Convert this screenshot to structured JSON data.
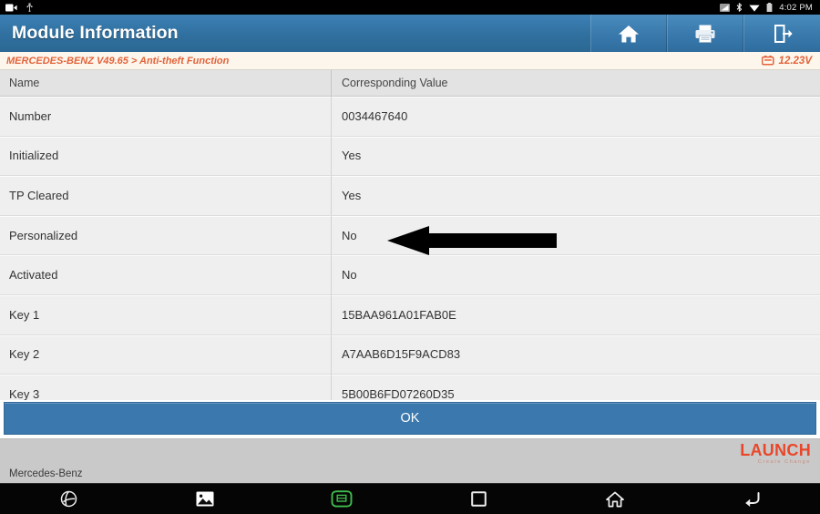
{
  "status_bar": {
    "left_icons": [
      "screen-record-icon",
      "usb-icon"
    ],
    "right_icons": [
      "signal-icon",
      "bluetooth-icon",
      "wifi-icon",
      "battery-icon"
    ],
    "time": "4:02 PM"
  },
  "title_bar": {
    "title": "Module Information",
    "actions": [
      {
        "name": "home-button",
        "icon": "home-icon"
      },
      {
        "name": "print-button",
        "icon": "printer-icon"
      },
      {
        "name": "exit-button",
        "icon": "exit-icon"
      }
    ]
  },
  "breadcrumb": {
    "path": "MERCEDES-BENZ V49.65 > Anti-theft Function",
    "voltage": "12.23V",
    "voltage_icon": "battery-icon",
    "accent_color": "#e2633a"
  },
  "table": {
    "headers": [
      "Name",
      "Corresponding Value"
    ],
    "rows": [
      {
        "name": "Number",
        "value": "0034467640"
      },
      {
        "name": "Initialized",
        "value": "Yes"
      },
      {
        "name": "TP Cleared",
        "value": "Yes"
      },
      {
        "name": "Personalized",
        "value": "No"
      },
      {
        "name": "Activated",
        "value": "No"
      },
      {
        "name": "Key 1",
        "value": "15BAA961A01FAB0E"
      },
      {
        "name": "Key 2",
        "value": "A7AAB6D15F9ACD83"
      },
      {
        "name": "Key 3",
        "value": "5B00B6FD07260D35"
      }
    ]
  },
  "annotation": {
    "name": "pointer-arrow",
    "direction": "left",
    "target_row": "Personalized"
  },
  "ok_button": {
    "label": "OK",
    "color": "#3b78ad"
  },
  "footer": {
    "brand": "LAUNCH",
    "brand_tagline": "Create Change",
    "vehicle": "Mercedes-Benz",
    "brand_color": "#e8472a"
  },
  "nav_bar": {
    "items": [
      {
        "name": "browser-icon"
      },
      {
        "name": "gallery-icon"
      },
      {
        "name": "obd-connector-icon"
      },
      {
        "name": "recents-icon"
      },
      {
        "name": "home-icon"
      },
      {
        "name": "back-icon"
      }
    ]
  }
}
